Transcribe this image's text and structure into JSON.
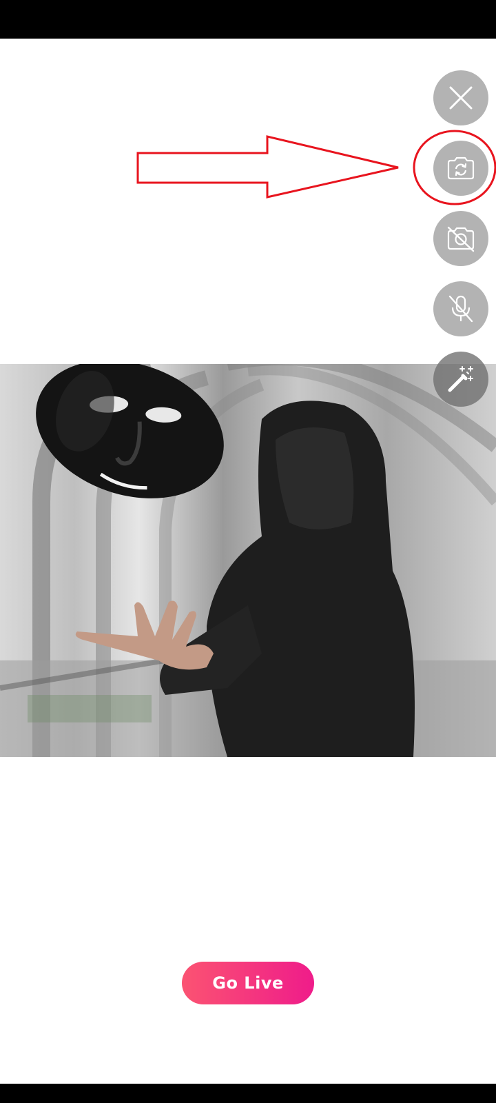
{
  "controls": {
    "close_icon": "close-icon",
    "flip_camera_icon": "flip-camera-icon",
    "camera_off_icon": "camera-off-icon",
    "mic_off_icon": "mic-off-icon",
    "beauty_filter_icon": "magic-wand-icon"
  },
  "colors": {
    "go_live_start": "#fb5372",
    "go_live_end": "#ef1c8a",
    "annotation": "#e8141e",
    "control_bg": "#969696"
  },
  "go_live": {
    "label": "Go Live"
  }
}
